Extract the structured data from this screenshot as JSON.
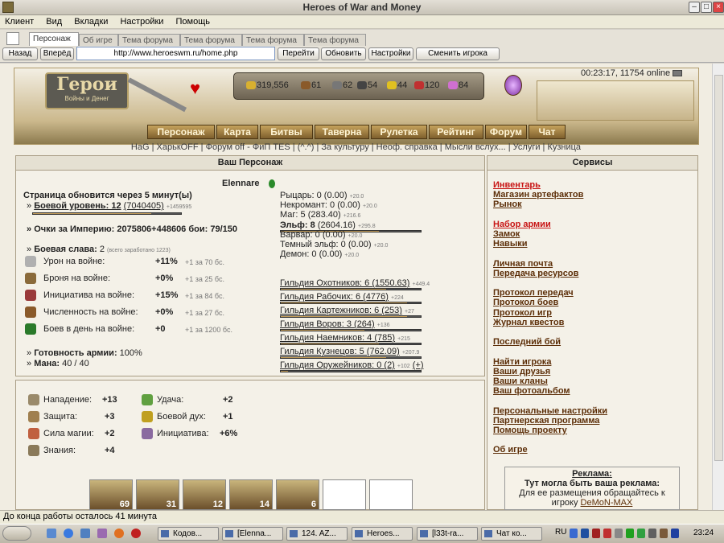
{
  "window": {
    "title": "Heroes of War and Money"
  },
  "menu": [
    "Клиент",
    "Вид",
    "Вкладки",
    "Настройки",
    "Помощь"
  ],
  "tabs": [
    "Персонаж",
    "Об игре",
    "Тема форума",
    "Тема форума",
    "Тема форума",
    "Тема форума"
  ],
  "nav": {
    "back": "Назад",
    "forward": "Вперёд",
    "url": "http://www.heroeswm.ru/home.php",
    "go": "Перейти",
    "refresh": "Обновить",
    "settings": "Настройки",
    "switch": "Сменить игрока"
  },
  "header": {
    "logo_title": "Герои",
    "logo_sub": "Войны и Денег",
    "clock": "00:23:17, 11754 online",
    "resources": [
      {
        "icon": "gold-icon",
        "value": "319,556",
        "color": "#d8b030"
      },
      {
        "icon": "wood-icon",
        "value": "61",
        "color": "#8a5a2a"
      },
      {
        "icon": "ore-icon",
        "value": "62",
        "color": "#777777"
      },
      {
        "icon": "mercury-icon",
        "value": "54",
        "color": "#444444"
      },
      {
        "icon": "sulfur-icon",
        "value": "44",
        "color": "#e0c020"
      },
      {
        "icon": "crystal-icon",
        "value": "120",
        "color": "#c03030"
      },
      {
        "icon": "gems-icon",
        "value": "84",
        "color": "#d070d0"
      }
    ],
    "nav_menu": [
      "Персонаж",
      "Карта",
      "Битвы",
      "Таверна",
      "Рулетка",
      "Рейтинг",
      "Форум",
      "Чат"
    ]
  },
  "sublinks": "HaG | ХарькOFF | Форум off - ФиП TES | (^.^) | За культуру | Неоф. справка | Мысли вслух... | Услуги | Кузница",
  "character": {
    "panel_title": "Ваш Персонаж",
    "name": "Elennare",
    "refresh_note": "Страница обновится через 5 минут(ы)",
    "combat_level_label": "Боевой уровень: 12",
    "combat_level_val": "(7040405)",
    "combat_level_delta": "+1459595",
    "empire_points": "Очки за Империю: 2075806+448606    бои: 79/150",
    "glory_label": "Боевая слава:",
    "glory_val": "2",
    "glory_note": "(всего заработано 1223)",
    "war_stats": [
      {
        "icon": "sword-icon",
        "label": "Урон на войне:",
        "value": "+11%",
        "note": "+1 за 70 бс."
      },
      {
        "icon": "armor-icon",
        "label": "Броня на войне:",
        "value": "+0%",
        "note": "+1 за 25 бс."
      },
      {
        "icon": "initiative-icon",
        "label": "Инициатива на войне:",
        "value": "+15%",
        "note": "+1 за 84 бс."
      },
      {
        "icon": "army-icon",
        "label": "Численность на войне:",
        "value": "+0%",
        "note": "+1 за 27 бс."
      },
      {
        "icon": "battles-icon",
        "label": "Боев в день на войне:",
        "value": "+0",
        "note": "+1 за 1200 бс."
      }
    ],
    "army_ready_label": "Готовность армии:",
    "army_ready_val": "100%",
    "mana_label": "Мана:",
    "mana_val": "40 / 40",
    "factions": [
      {
        "label": "Рыцарь: 0 (0.00)",
        "delta": "+20.0",
        "bold": false
      },
      {
        "label": "Некромант: 0 (0.00)",
        "delta": "+20.0",
        "bold": false
      },
      {
        "label": "Маг: 5 (283.40)",
        "delta": "+216.6",
        "bold": false
      },
      {
        "label": "Эльф: 8",
        "val": "(2604.16)",
        "delta": "+295.8",
        "bold": true
      },
      {
        "label": "Варвар: 0 (0.00)",
        "delta": "+20.0",
        "bold": false
      },
      {
        "label": "Темный эльф: 0 (0.00)",
        "delta": "+20.0",
        "bold": false
      },
      {
        "label": "Демон: 0 (0.00)",
        "delta": "+20.0",
        "bold": false
      }
    ],
    "guilds": [
      {
        "label": "Гильдия Охотников: 6 (1550.63)",
        "delta": "+449.4",
        "fill": 0.75
      },
      {
        "label": "Гильдия Рабочих: 6 (4776)",
        "delta": "+224",
        "fill": 0.9
      },
      {
        "label": "Гильдия Картежников: 6 (253)",
        "delta": "+27",
        "fill": 0.9
      },
      {
        "label": "Гильдия Воров: 3 (264)",
        "delta": "+136",
        "fill": 0.6
      },
      {
        "label": "Гильдия Наемников: 4 (785)",
        "delta": "+215",
        "fill": 0.7
      },
      {
        "label": "Гильдия Кузнецов: 5 (762.09)",
        "delta": "+207.9",
        "fill": 0.75
      },
      {
        "label": "Гильдия Оружейников: 0 (2)",
        "delta": "+102",
        "plus": "(+)",
        "fill": 0.05
      }
    ]
  },
  "stats": [
    {
      "icon": "attack-icon",
      "label": "Нападение:",
      "value": "+13"
    },
    {
      "icon": "defense-icon",
      "label": "Защита:",
      "value": "+3"
    },
    {
      "icon": "spellpower-icon",
      "label": "Сила магии:",
      "value": "+2"
    },
    {
      "icon": "knowledge-icon",
      "label": "Знания:",
      "value": "+4"
    },
    {
      "icon": "luck-icon",
      "label": "Удача:",
      "value": "+2"
    },
    {
      "icon": "morale-icon",
      "label": "Боевой дух:",
      "value": "+1"
    },
    {
      "icon": "initiative2-icon",
      "label": "Инициатива:",
      "value": "+6%"
    }
  ],
  "army": [
    {
      "count": "69"
    },
    {
      "count": "31"
    },
    {
      "count": "12"
    },
    {
      "count": "14"
    },
    {
      "count": "6"
    },
    {
      "count": ""
    },
    {
      "count": ""
    }
  ],
  "services": {
    "title": "Сервисы",
    "links": [
      {
        "text": "Инвентарь",
        "red": true
      },
      {
        "text": "Магазин артефактов"
      },
      {
        "text": "Рынок"
      },
      {
        "text": "Набор армии",
        "red": true
      },
      {
        "text": "Замок"
      },
      {
        "text": "Навыки"
      },
      {
        "text": "Личная почта"
      },
      {
        "text": "Передача ресурсов"
      },
      {
        "text": "Протокол передач"
      },
      {
        "text": "Протокол боев"
      },
      {
        "text": "Протокол игр"
      },
      {
        "text": "Журнал квестов"
      },
      {
        "text": "Последний бой"
      },
      {
        "text": "Найти игрока"
      },
      {
        "text": "Ваши друзья"
      },
      {
        "text": "Ваши кланы"
      },
      {
        "text": "Ваш фотоальбом"
      },
      {
        "text": "Персональные настройки"
      },
      {
        "text": "Партнерская программа"
      },
      {
        "text": "Помощь проекту"
      },
      {
        "text": "Об игре"
      }
    ],
    "ad_title": "Реклама:",
    "ad_line1": "Тут могла быть ваша реклама:",
    "ad_line2": "Для ее размещения обращайтесь к",
    "ad_line3": "игроку",
    "ad_player": "DeMoN-MAX"
  },
  "status_text": "До конца работы осталось 41 минута",
  "taskbar": {
    "items": [
      "Кодов...",
      "[Elenna...",
      "124. AZ...",
      "Heroes...",
      "[l33t-ra...",
      "Чат ко..."
    ],
    "lang": "RU",
    "time": "23:24"
  }
}
